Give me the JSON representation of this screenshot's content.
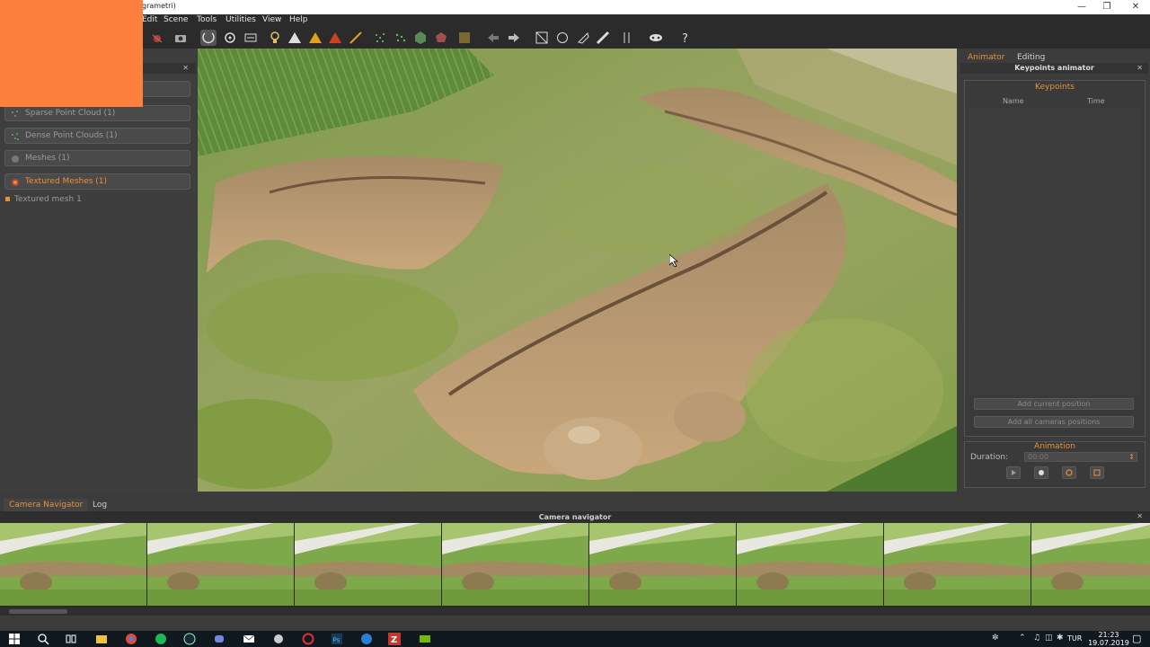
{
  "window": {
    "title_fragment": "grametri)",
    "controls": [
      "minimize",
      "restore",
      "close"
    ]
  },
  "menubar": [
    "Edit",
    "Scene",
    "Tools",
    "Utilities",
    "View",
    "Help"
  ],
  "toolbar": {
    "icons": [
      "bug-icon",
      "camera-icon",
      "orbit-icon",
      "rotate-icon",
      "fit-icon",
      "light-icon",
      "triangle-icon",
      "triangle-alt-icon",
      "triangle-red-icon",
      "brush-icon",
      "points-icon",
      "points-alt-icon",
      "cube-icon",
      "mesh-icon",
      "texture-icon",
      "undo-icon",
      "redo-icon",
      "select-icon",
      "lasso-icon",
      "cut-icon",
      "ruler-icon",
      "tools-icon",
      "mask-icon",
      "help-icon"
    ]
  },
  "left_panel": {
    "items": [
      {
        "label": "Sparse Point Cloud (1)",
        "active": false
      },
      {
        "label": "Dense Point Clouds (1)",
        "active": false
      },
      {
        "label": "Meshes (1)",
        "active": false
      },
      {
        "label": "Textured Meshes (1)",
        "active": true
      }
    ],
    "sub_item": "Textured mesh 1"
  },
  "right_panel": {
    "tabs": [
      "Animator",
      "Editing"
    ],
    "active_tab": "Animator",
    "title": "Keypoints animator",
    "keypoints": {
      "header": "Keypoints",
      "columns": [
        "Name",
        "Time"
      ]
    },
    "buttons": {
      "add_current": "Add current position",
      "add_all": "Add all cameras positions"
    },
    "animation": {
      "header": "Animation",
      "duration_label": "Duration:",
      "duration_value": "00:00"
    }
  },
  "bottom": {
    "tabs": [
      "Camera Navigator",
      "Log"
    ],
    "active_tab": "Camera Navigator",
    "navigator_title": "Camera navigator",
    "thumbnail_count": 8
  },
  "taskbar": {
    "apps": [
      "windows-start-icon",
      "search-icon",
      "task-view-icon",
      "file-explorer-icon",
      "chrome-icon",
      "spotify-icon",
      "steam-icon",
      "discord-icon",
      "mail-icon",
      "app-icon",
      "opera-icon",
      "photoshop-icon",
      "vpn-icon",
      "zotero-icon",
      "nvidia-icon"
    ],
    "tray": {
      "language": "TUR",
      "time": "21:23",
      "date": "19.07.2019"
    }
  },
  "colors": {
    "accent_orange": "#e8913a",
    "overlay_orange": "#ff7f3f",
    "panel_bg": "#3c3c3c",
    "toolbar_bg": "#2b2b2b"
  }
}
